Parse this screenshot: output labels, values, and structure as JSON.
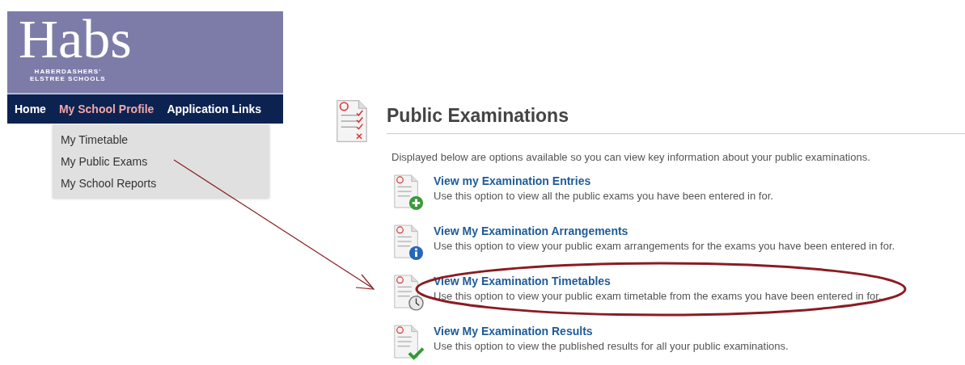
{
  "logo": {
    "wordmark": "Habs",
    "subtitle_lines": [
      "HABERDASHERS'",
      "ELSTREE SCHOOLS"
    ]
  },
  "nav": [
    {
      "label": "Home",
      "selected": false
    },
    {
      "label": "My School Profile",
      "selected": true
    },
    {
      "label": "Application Links",
      "selected": false
    }
  ],
  "dropdown": {
    "items": [
      "My Timetable",
      "My Public Exams",
      "My School Reports"
    ]
  },
  "page": {
    "title": "Public Examinations",
    "intro": "Displayed below are options available so you can view key information about your public examinations.",
    "options": [
      {
        "kind": "plus",
        "title": "View my Examination Entries",
        "description": "Use this option to view all the public exams you have been entered in for.",
        "circled": false
      },
      {
        "kind": "info",
        "title": "View My Examination Arrangements",
        "description": "Use this option to view your public exam arrangements for the exams you have been entered in for.",
        "circled": false
      },
      {
        "kind": "clock",
        "title": "View My Examination Timetables",
        "description": "Use this option to view your public exam timetable from the exams you have been entered in for.",
        "circled": true
      },
      {
        "kind": "check",
        "title": "View My Examination Results",
        "description": "Use this option to view the published results for all your public examinations.",
        "circled": false
      }
    ]
  }
}
